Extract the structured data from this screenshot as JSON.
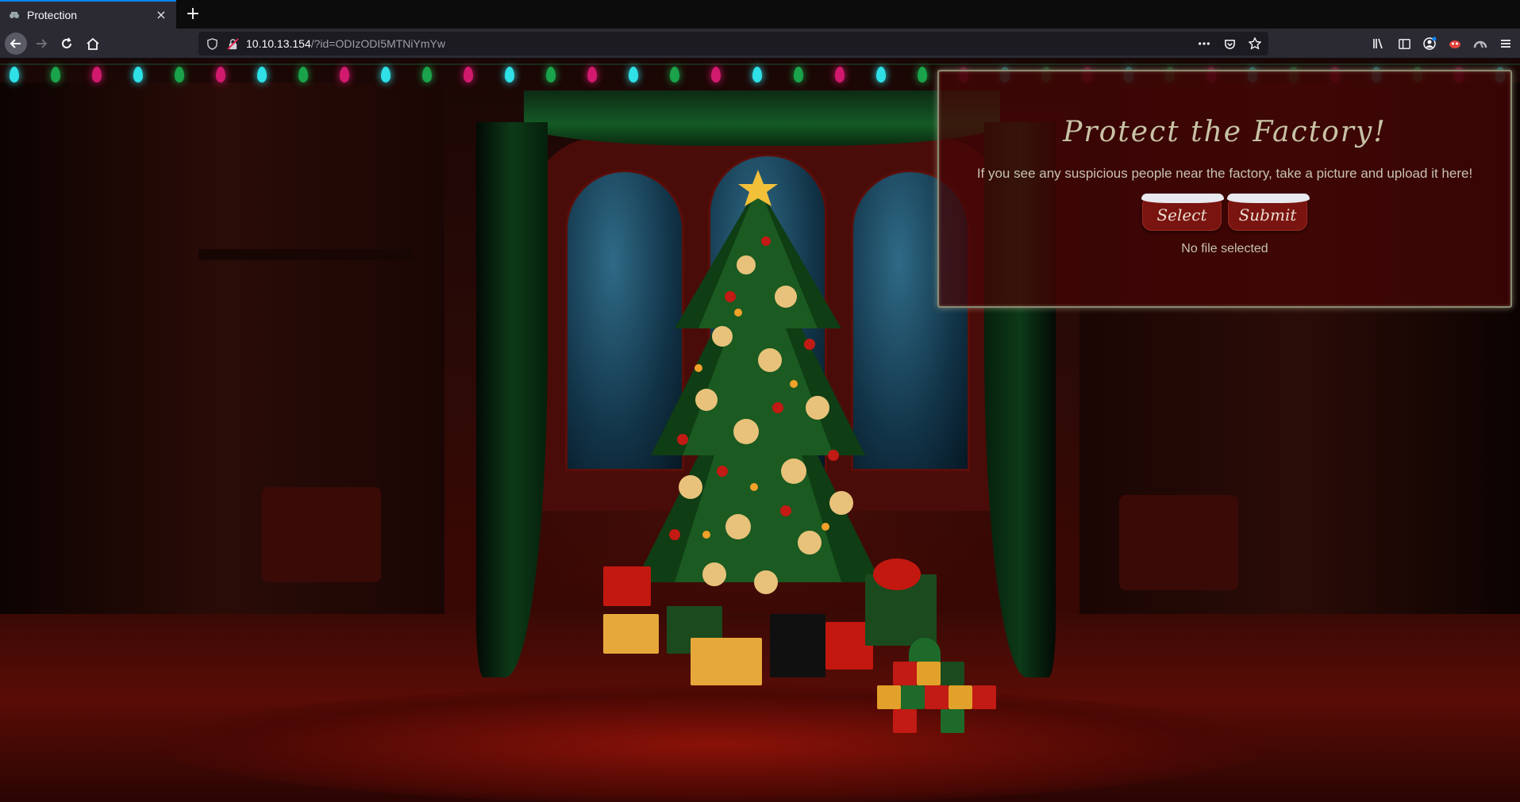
{
  "browser": {
    "tab_title": "Protection",
    "tab_close": "×",
    "new_tab": "+",
    "url_host": "10.10.13.154",
    "url_path": "/?id=ODIzODI5MTNiYmYw",
    "icons": [
      "back-icon",
      "forward-icon",
      "reload-icon",
      "home-icon",
      "shield-icon",
      "insecure-lock-icon",
      "more-icon",
      "pocket-icon",
      "bookmark-star-icon",
      "library-icon",
      "sidebar-icon",
      "account-icon",
      "extension-icon",
      "extension-icon",
      "menu-icon"
    ]
  },
  "panel": {
    "title": "Protect the Factory!",
    "description": "If you see any suspicious people near the factory, take a picture and upload it here!",
    "select_label": "Select",
    "submit_label": "Submit",
    "file_status": "No file selected"
  },
  "colors": {
    "panel_bg": "#460505",
    "panel_border": "#8a8a70",
    "button_bg": "#7a1410",
    "snow": "#e8e8ee",
    "title_text": "#c8c3a6"
  }
}
